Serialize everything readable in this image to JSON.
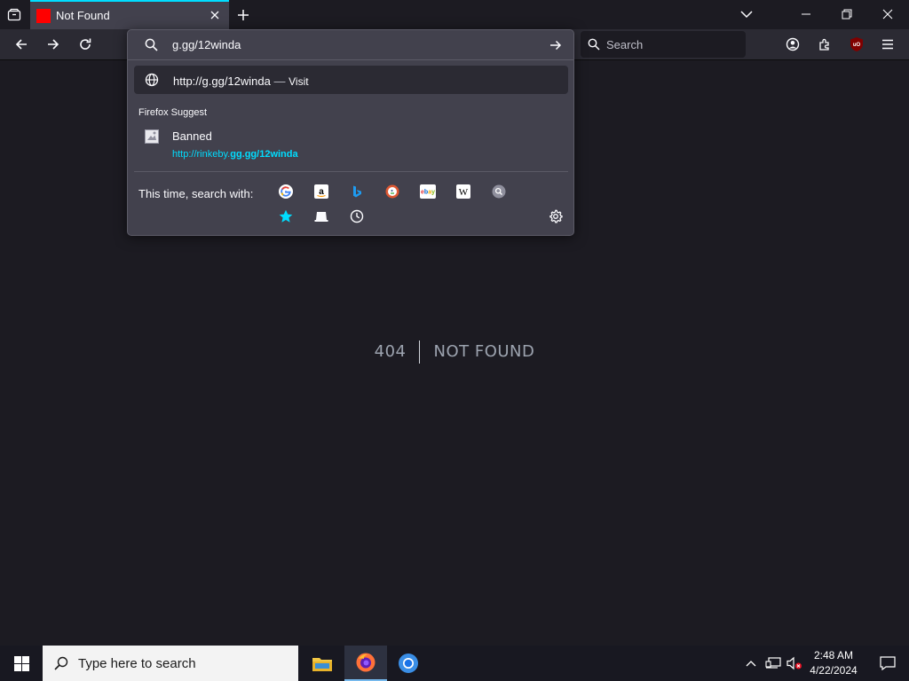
{
  "tab": {
    "title": "Not Found"
  },
  "navbar": {
    "search_placeholder": "Search"
  },
  "urlbar": {
    "input_value": "g.gg/12winda",
    "visit": {
      "url": "http://g.gg/12winda",
      "separator": "—",
      "action": "Visit"
    },
    "suggest_header": "Firefox Suggest",
    "suggestion": {
      "title": "Banned",
      "url_prefix": "http://rinkeby.",
      "url_match": "gg.gg/12winda"
    },
    "oneoff_label": "This time, search with:",
    "engines": [
      "google",
      "amazon",
      "bing",
      "duckduckgo",
      "ebay",
      "wikipedia",
      "search",
      "bookmarks",
      "tabs",
      "history"
    ]
  },
  "page": {
    "code": "404",
    "message": "NOT FOUND"
  },
  "taskbar": {
    "search_placeholder": "Type here to search",
    "time": "2:48 AM",
    "date": "4/22/2024"
  },
  "colors": {
    "accent": "#00ddff",
    "favicon": "#ff0000",
    "ublock": "#800000"
  }
}
